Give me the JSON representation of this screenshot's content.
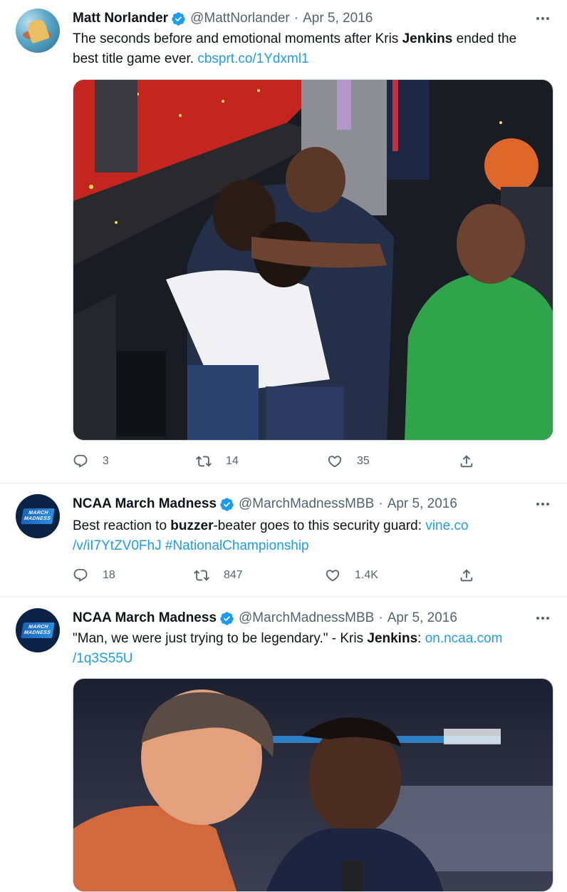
{
  "tweets": [
    {
      "name": "Matt Norlander",
      "handle": "@MattNorlander",
      "date": "Apr 5, 2016",
      "text_before": "The seconds before and emotional moments after Kris ",
      "text_bold": "Jenkins",
      "text_after": " ended the best title game ever. ",
      "link": "cbsprt.co/1Ydxml1",
      "replies": "3",
      "retweets": "14",
      "likes": "35"
    },
    {
      "name": "NCAA March Madness",
      "handle": "@MarchMadnessMBB",
      "date": "Apr 5, 2016",
      "text_before": "Best reaction to ",
      "text_bold": "buzzer",
      "text_after": "-beater goes to this security guard: ",
      "link_line1": "vine.co",
      "link_line2": "/v/iI7YtZV0FhJ",
      "hashtag": "#NationalChampionship",
      "replies": "18",
      "retweets": "847",
      "likes": "1.4K"
    },
    {
      "name": "NCAA March Madness",
      "handle": "@MarchMadnessMBB",
      "date": "Apr 5, 2016",
      "text_before": "\"Man, we were just trying to be legendary.\" - Kris ",
      "text_bold": "Jenkins",
      "text_after": ": ",
      "link_line1": "on.ncaa.com",
      "link_line2": "/1q3S55U"
    }
  ],
  "avatar_logo_text": "MARCH MADNESS",
  "separator": "·",
  "colors": {
    "link": "#1d9bf0",
    "muted": "#536471",
    "verified": "#1d9bf0"
  }
}
